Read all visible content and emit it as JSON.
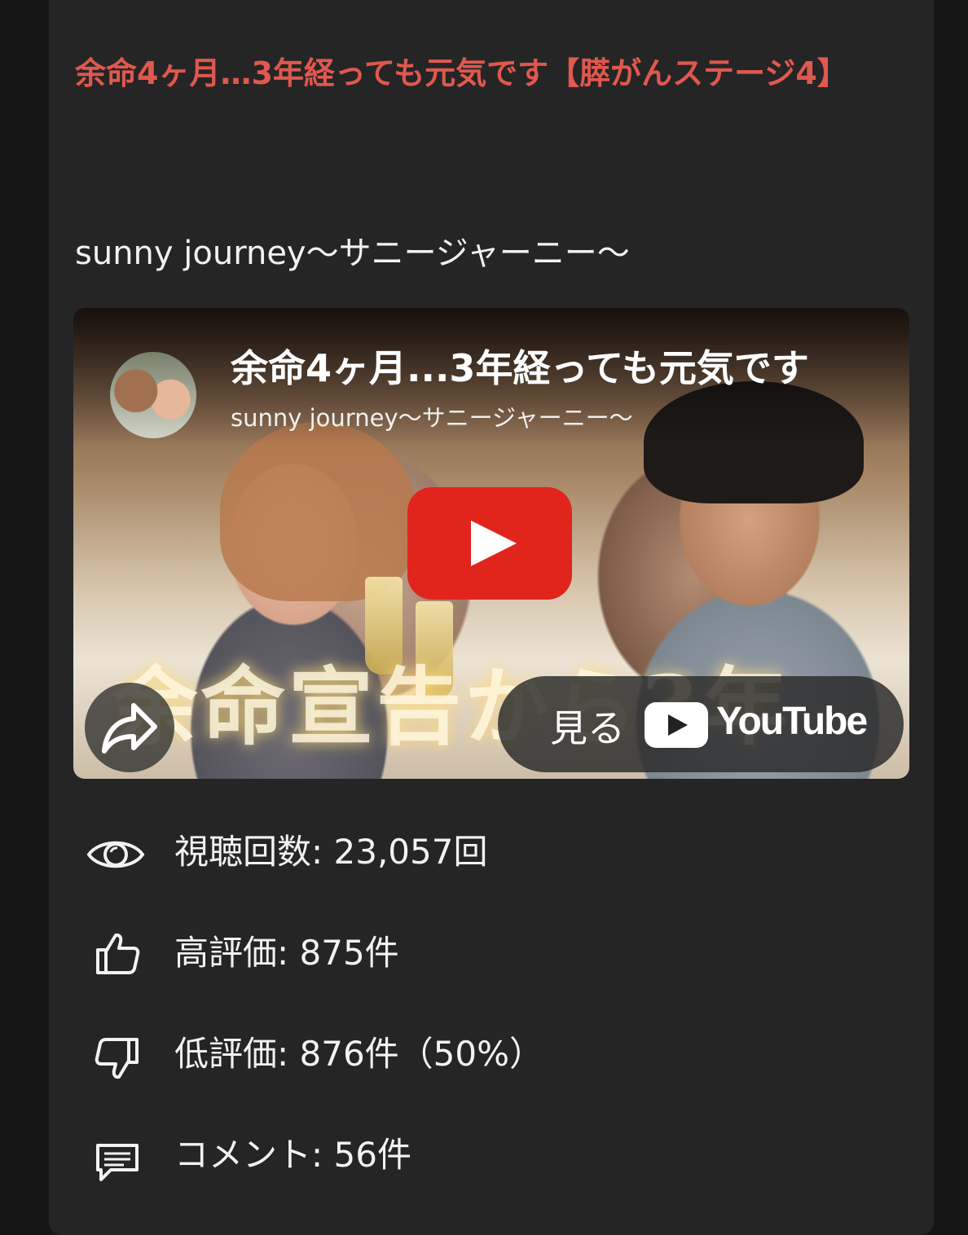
{
  "post": {
    "title": "余命4ヶ月…3年経っても元気です【膵がんステージ4】",
    "channel": "sunny journey〜サニージャーニー〜"
  },
  "player": {
    "video_title": "余命4ヶ月...3年経っても元気です",
    "channel_name": "sunny journey〜サニージャーニー〜",
    "thumbnail_text": "余命宣告から3年",
    "watch_label": "見る",
    "youtube_wordmark": "YouTube",
    "play_button_color": "#e1251c"
  },
  "stats": {
    "views": "視聴回数: 23,057回",
    "likes": "高評価: 875件",
    "dislikes": "低評価: 876件（50%）",
    "comments": "コメント: 56件"
  },
  "icons": [
    "eye-icon",
    "thumbs-up-icon",
    "thumbs-down-icon",
    "comment-icon",
    "share-icon",
    "youtube-logo-icon",
    "play-icon"
  ],
  "colors": {
    "title": "#e0584e",
    "card_background": "#252526",
    "page_background": "#161616",
    "text": "#f2f2f2"
  }
}
